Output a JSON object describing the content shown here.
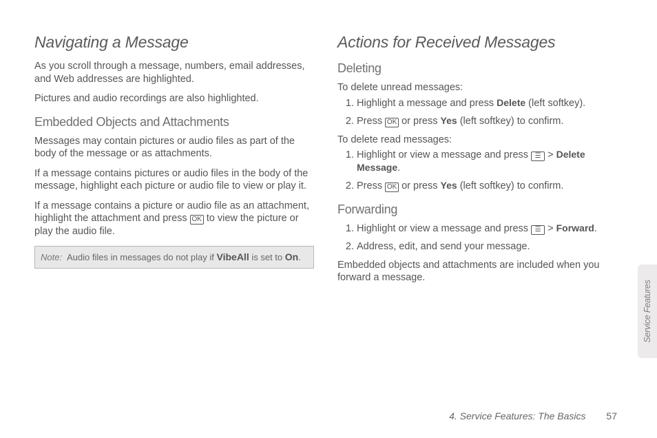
{
  "left": {
    "h1": "Navigating a Message",
    "p1": "As you scroll through a message, numbers, email addresses, and Web addresses are highlighted.",
    "p2": "Pictures and audio recordings are also highlighted.",
    "h2": "Embedded Objects and Attachments",
    "p3": "Messages may contain pictures or audio files as part of the body of the message or as attachments.",
    "p4": "If a message contains pictures or audio files in the body of the message, highlight each picture or audio file to view or play it.",
    "p5a": "If a message contains a picture or audio file as an attachment, highlight the attachment and press ",
    "p5b": " to view the picture or play the audio file.",
    "note_label": "Note:",
    "note_a": "Audio files in messages do not play if ",
    "note_bold1": "VibeAll",
    "note_b": " is set to ",
    "note_bold2": "On",
    "note_c": "."
  },
  "right": {
    "h1": "Actions for Received Messages",
    "h2a": "Deleting",
    "intro1": "To delete unread messages:",
    "d1a": "Highlight a message and press ",
    "d1_bold": "Delete",
    "d1b": " (left softkey).",
    "d2a": "Press ",
    "d2b": " or press ",
    "d2_bold": "Yes",
    "d2c": " (left softkey) to confirm.",
    "intro2": "To delete read messages:",
    "d3a": "Highlight or view a message and press ",
    "d3b": " > ",
    "d3_bold": "Delete Message",
    "d3c": ".",
    "d4a": "Press ",
    "d4b": " or press ",
    "d4_bold": "Yes",
    "d4c": " (left softkey) to confirm.",
    "h2b": "Forwarding",
    "f1a": "Highlight or view a message and press ",
    "f1b": " > ",
    "f1_bold": "Forward",
    "f1c": ".",
    "f2": "Address, edit, and send your message.",
    "p_last": "Embedded objects and attachments are included when you forward a message."
  },
  "icons": {
    "ok": "OK",
    "menu": "☰"
  },
  "footer": {
    "section": "4. Service Features: The Basics",
    "page": "57"
  },
  "sidetab": "Service Features"
}
